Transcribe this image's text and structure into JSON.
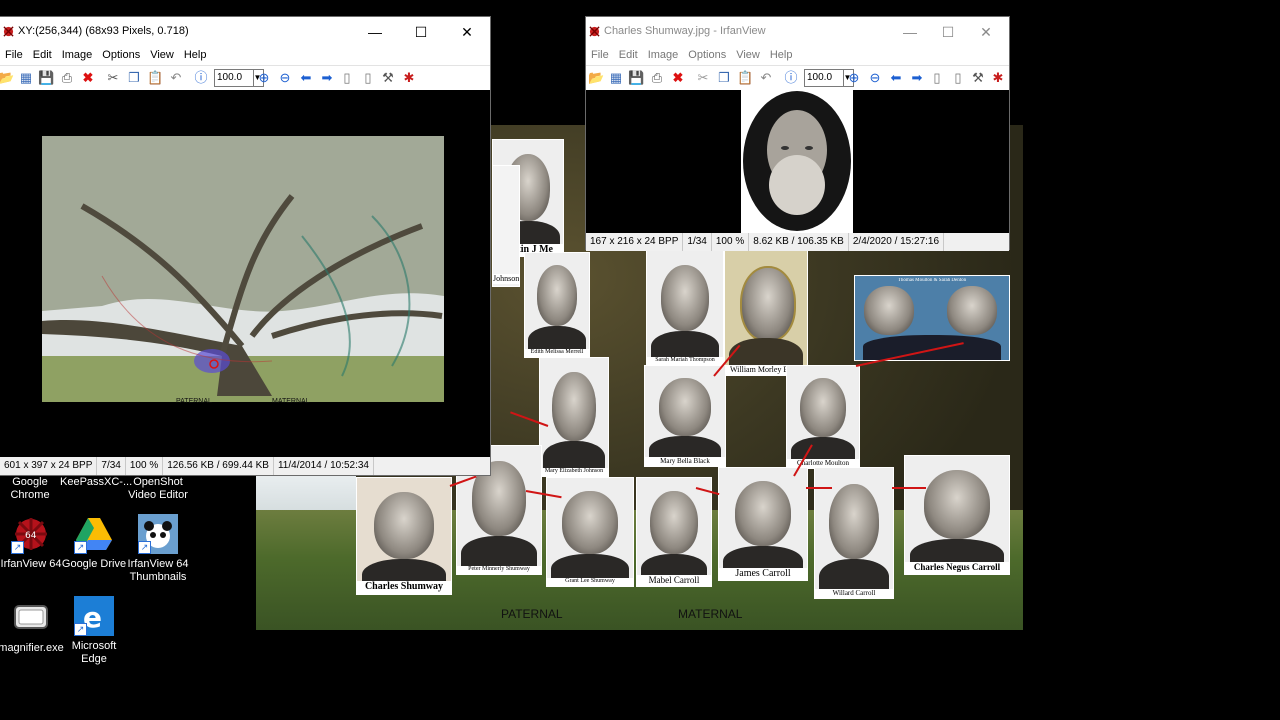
{
  "window_left": {
    "title": "XY:(256,344) (68x93 Pixels, 0.718)",
    "menu": [
      "File",
      "Edit",
      "Image",
      "Options",
      "View",
      "Help"
    ],
    "zoom": "100.0",
    "status": [
      "601 x 397 x 24 BPP",
      "7/34",
      "100 %",
      "126.56 KB / 699.44 KB",
      "11/4/2014 / 10:52:34"
    ]
  },
  "window_right": {
    "title": "Charles Shumway.jpg - IrfanView",
    "menu": [
      "File",
      "Edit",
      "Image",
      "Options",
      "View",
      "Help"
    ],
    "zoom": "100.0",
    "status": [
      "167 x 216 x 24 BPP",
      "1/34",
      "100 %",
      "8.62 KB / 106.35 KB",
      "2/4/2020 / 15:27:16"
    ]
  },
  "desktop_icons": [
    {
      "label": "Google Chrome"
    },
    {
      "label": "KeePassXC-..."
    },
    {
      "label": "OpenShot Video Editor"
    },
    {
      "label": "IrfanView 64"
    },
    {
      "label": "Google Drive"
    },
    {
      "label": "IrfanView 64 Thumbnails"
    },
    {
      "label": "magnifier.exe"
    },
    {
      "label": "Microsoft Edge"
    }
  ],
  "collage": {
    "labels": {
      "paternal": "PATERNAL",
      "maternal": "MATERNAL",
      "left_paternal": "PATERNAL",
      "left_maternal": "MATERNAL"
    },
    "people": [
      {
        "name": "Justin J Me"
      },
      {
        "name": "Johnson"
      },
      {
        "name": "Edith Melissa Merrell"
      },
      {
        "name": "Sarah Mariah Thompson"
      },
      {
        "name": "William Morley Black"
      },
      {
        "name": "Thomas Moulton & Sarah Denton"
      },
      {
        "name": "Mary Elizabeth Johnson"
      },
      {
        "name": "Mary Bella Black"
      },
      {
        "name": "Charlotte Moulton"
      },
      {
        "name": "Charles Shumway"
      },
      {
        "name": "Peter Minnerly Shumway"
      },
      {
        "name": "Grant Lee Shumway"
      },
      {
        "name": "Mabel Carroll"
      },
      {
        "name": "James Carroll"
      },
      {
        "name": "Willard Carroll"
      },
      {
        "name": "Charles Negus Carroll"
      }
    ]
  },
  "colors": {
    "irfan_red": "#c81e1e",
    "arrow_red": "#d01515",
    "status_bg": "#f0f0f0"
  },
  "icons": [
    "open-icon",
    "thumbnails-icon",
    "save-icon",
    "print-icon",
    "delete-icon",
    "cut-icon",
    "copy-icon",
    "paste-icon",
    "undo-icon",
    "info-icon",
    "zoom-in-icon",
    "zoom-out-icon",
    "previous-icon",
    "next-icon",
    "first-page-icon",
    "last-page-icon",
    "settings-icon",
    "irfanview-icon"
  ]
}
